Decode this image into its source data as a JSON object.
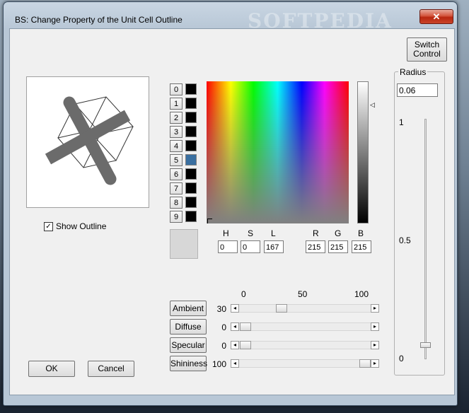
{
  "window": {
    "title": "BS: Change Property of the Unit Cell Outline",
    "watermark": "SOFTPEDIA",
    "close_glyph": "✕"
  },
  "switch_control": {
    "line1": "Switch",
    "line2": "Control"
  },
  "radius": {
    "label": "Radius",
    "value": "0.06",
    "ticks": [
      "1",
      "0.5",
      "0"
    ],
    "slider_value": 0.06
  },
  "show_outline": {
    "label": "Show Outline",
    "checked": true,
    "glyph": "✓"
  },
  "color_indices": [
    {
      "label": "0",
      "color": "#000000"
    },
    {
      "label": "1",
      "color": "#000000"
    },
    {
      "label": "2",
      "color": "#000000"
    },
    {
      "label": "3",
      "color": "#000000"
    },
    {
      "label": "4",
      "color": "#000000"
    },
    {
      "label": "5",
      "color": "#3a6fa0"
    },
    {
      "label": "6",
      "color": "#000000"
    },
    {
      "label": "7",
      "color": "#000000"
    },
    {
      "label": "8",
      "color": "#000000"
    },
    {
      "label": "9",
      "color": "#000000"
    }
  ],
  "current_color": "#d7d7d7",
  "hsl": {
    "h_label": "H",
    "s_label": "S",
    "l_label": "L",
    "h": "0",
    "s": "0",
    "l": "167"
  },
  "rgb": {
    "r_label": "R",
    "g_label": "G",
    "b_label": "B",
    "r": "215",
    "g": "215",
    "b": "215"
  },
  "scale_labels": [
    "0",
    "50",
    "100"
  ],
  "sliders": [
    {
      "label": "Ambient",
      "value": "30",
      "fraction": 0.3
    },
    {
      "label": "Diffuse",
      "value": "0",
      "fraction": 0.0
    },
    {
      "label": "Specular",
      "value": "0",
      "fraction": 0.0
    },
    {
      "label": "Shininess",
      "value": "100",
      "fraction": 1.0
    }
  ],
  "buttons": {
    "ok": "OK",
    "cancel": "Cancel"
  }
}
